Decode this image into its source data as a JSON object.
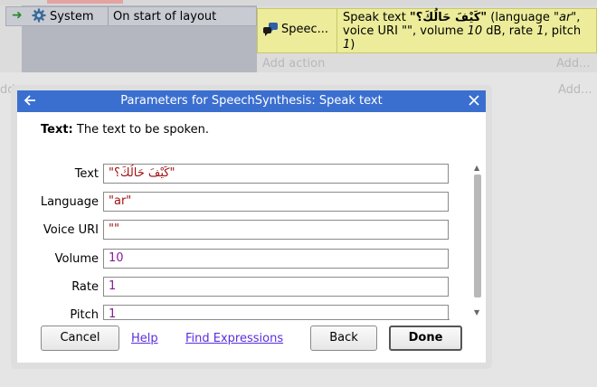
{
  "event": {
    "condition_object": "System",
    "condition_text": "On start of layout",
    "action_object": "Speec...",
    "action_desc_prefix": "Speak text ",
    "action_desc_quoted": "\"كَيْفَ حَالُكَ؟\"",
    "action_desc_rest_1": " (language ",
    "action_lang": "\"ar\"",
    "action_desc_rest_2": ", voice URI ",
    "action_voice": "\"\"",
    "action_desc_rest_3": ", volume ",
    "action_volume": "10",
    "action_desc_rest_4": " dB, rate ",
    "action_rate": "1",
    "action_desc_rest_5": ", pitch ",
    "action_pitch": "1",
    "action_desc_rest_6": ")",
    "add_action": "Add action",
    "add_short": "Add..."
  },
  "dialog": {
    "title": "Parameters for SpeechSynthesis: Speak text",
    "desc_label": "Text:",
    "desc_text": " The text to be spoken.",
    "params": [
      {
        "label": "Text",
        "value": "\"كَيْفَ حَالُكَ؟\""
      },
      {
        "label": "Language",
        "value": "\"ar\""
      },
      {
        "label": "Voice URI",
        "value": "\"\""
      },
      {
        "label": "Volume",
        "value": "10"
      },
      {
        "label": "Rate",
        "value": "1"
      },
      {
        "label": "Pitch",
        "value": "1"
      }
    ],
    "buttons": {
      "cancel": "Cancel",
      "help": "Help",
      "find_expressions": "Find Expressions",
      "back": "Back",
      "done": "Done"
    }
  },
  "colors": {
    "titlebar": "#3a6fd0",
    "action_bg": "#ecec9a",
    "string_value": "#a01010",
    "number_value": "#8a1a9a",
    "link": "#5a2de0"
  }
}
